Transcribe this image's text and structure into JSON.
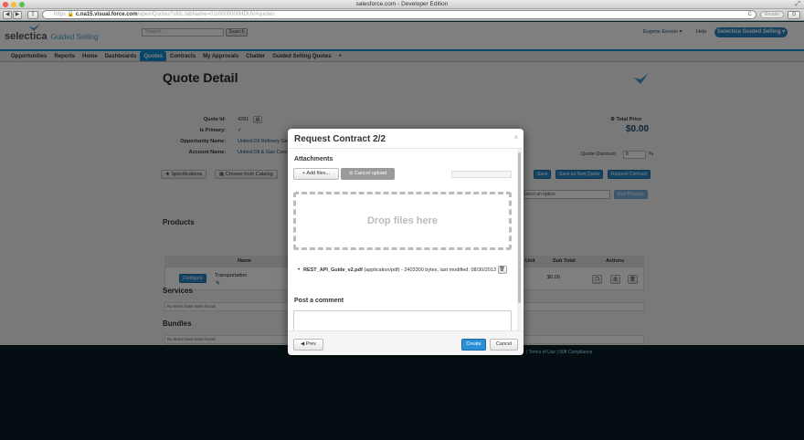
{
  "window": {
    "title": "salesforce.com - Developer Edition"
  },
  "browser": {
    "back": "◀",
    "forward": "▶",
    "share": "⇪",
    "url_scheme": "https",
    "url_host": "c.na15.visual.force.com",
    "url_path": "/apex/Quotes?sfdc.tabName=01r0000000HDUV#quotes",
    "reader": "Reader",
    "reload": "C"
  },
  "header": {
    "logo": "selectica",
    "logo_sub": "Guided Selling",
    "search_placeholder": "Search...",
    "search_button": "Search",
    "user_menu": "Eugene Eeroun ▾",
    "help": "Help",
    "app_menu": "Selectica Guided Selling ▾"
  },
  "tabs": [
    {
      "label": "Opportunities"
    },
    {
      "label": "Reports"
    },
    {
      "label": "Home"
    },
    {
      "label": "Dashboards"
    },
    {
      "label": "Quotes"
    },
    {
      "label": "Contracts"
    },
    {
      "label": "My Approvals"
    },
    {
      "label": "Chatter"
    },
    {
      "label": "Guided Selling Quotes"
    },
    {
      "label": "+"
    }
  ],
  "quote": {
    "title": "Quote Detail",
    "id_label": "Quote Id:",
    "id_value": "4281",
    "primary_label": "Is Primary:",
    "primary_value": "✓",
    "opportunity_label": "Opportunity Name:",
    "opportunity_value": "United Oil Refinery Generators",
    "account_label": "Account Name:",
    "account_value": "United Oil & Gas Corp.",
    "total_label": "Total Price",
    "total_value": "$0.00",
    "discount_label": "Quote Discount",
    "discount_value": "0",
    "discount_unit": "%",
    "specifications": "Specifications",
    "choose_catalog": "Choose from Catalog",
    "save": "Save",
    "save_new": "Save as New Quote",
    "request_contract": "Request Contract",
    "option_placeholder": "Select an option",
    "submit_btn": "Run Process"
  },
  "products": {
    "title": "Products",
    "columns": {
      "name": "Name",
      "unit": "Unit",
      "subtotal": "Sub Total",
      "actions": "Actions"
    },
    "row": {
      "configure": "Configure",
      "name": "Transportation",
      "subtotal": "$0.00"
    }
  },
  "services": {
    "title": "Services",
    "empty": "No items have been found"
  },
  "bundles": {
    "title": "Bundles",
    "empty": "No items have been found"
  },
  "footer": {
    "links": "| Terms of Use | 508 Compliance"
  },
  "modal": {
    "title": "Request Contract 2/2",
    "close": "×",
    "attachments_label": "Attachments",
    "add_files": "+ Add files...",
    "cancel_upload": "⊘ Cancel upload",
    "drop_text": "Drop files here",
    "file_name": "REST_API_Guide_v2.pdf",
    "file_meta": "(application/pdf) - 2403300 bytes, last modified:",
    "file_date": "08/30/2013",
    "post_comment_label": "Post a comment",
    "prev": "◀ Prev",
    "create": "Create",
    "cancel": "Cancel"
  },
  "colors": {
    "accent": "#0f8ad2",
    "primary_button": "#2a90d6",
    "overlay": "#000000"
  }
}
